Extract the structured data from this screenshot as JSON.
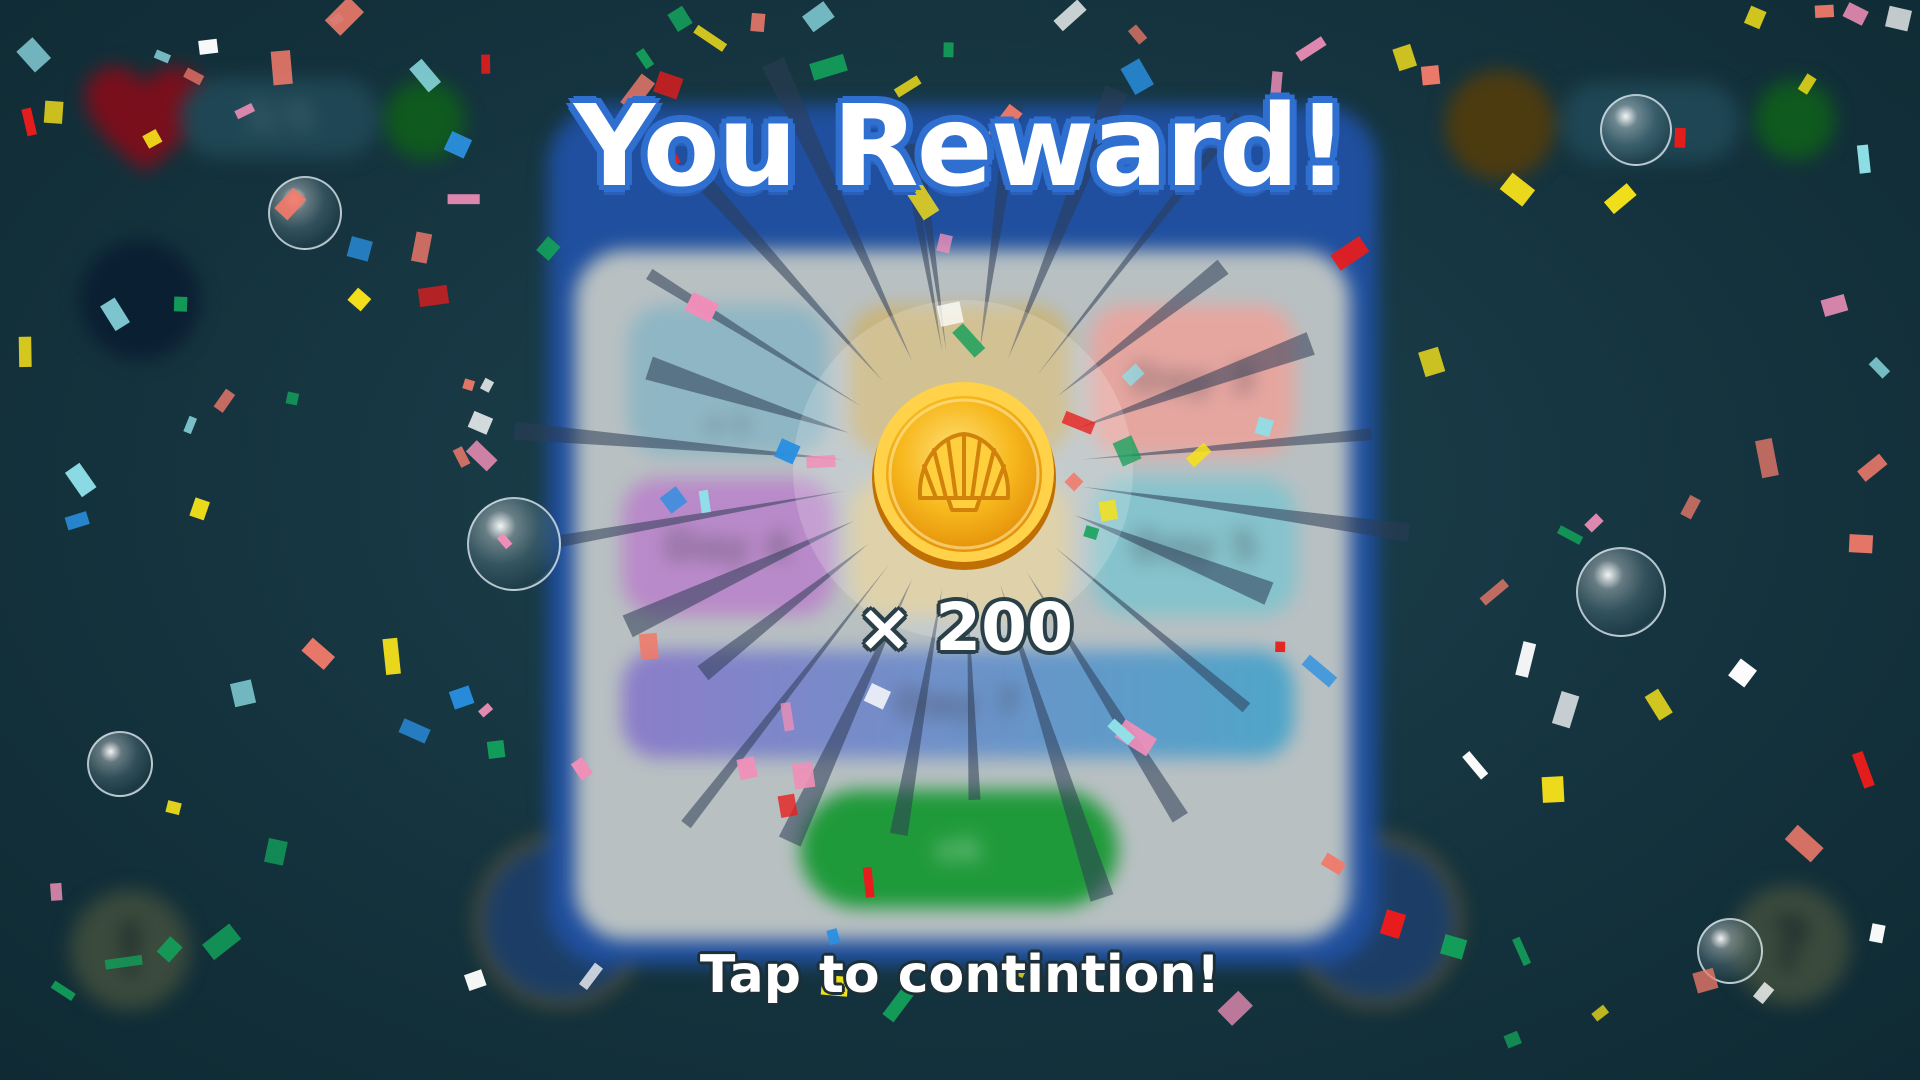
{
  "dialog": {
    "title": "You Reward!",
    "reward": {
      "item_icon": "shell-coin-icon",
      "amount_text": "× 200"
    },
    "continue_text": "Tap to contintion!"
  },
  "background": {
    "lives_text": "5/5",
    "panel_cards": [
      "Day 3",
      "Day 4",
      "Day 5",
      "Day 7"
    ],
    "panel_card_small_text": "x 1",
    "ok_button_label": "ok",
    "help_glyph": "?",
    "alert_glyph": "!"
  },
  "colors": {
    "background": "#15343f",
    "title_outline": "#2f6fd0",
    "coin_gold": "#f6b51c",
    "panel_blue": "#1f4f9e",
    "ok_green": "#1f9a3a"
  }
}
